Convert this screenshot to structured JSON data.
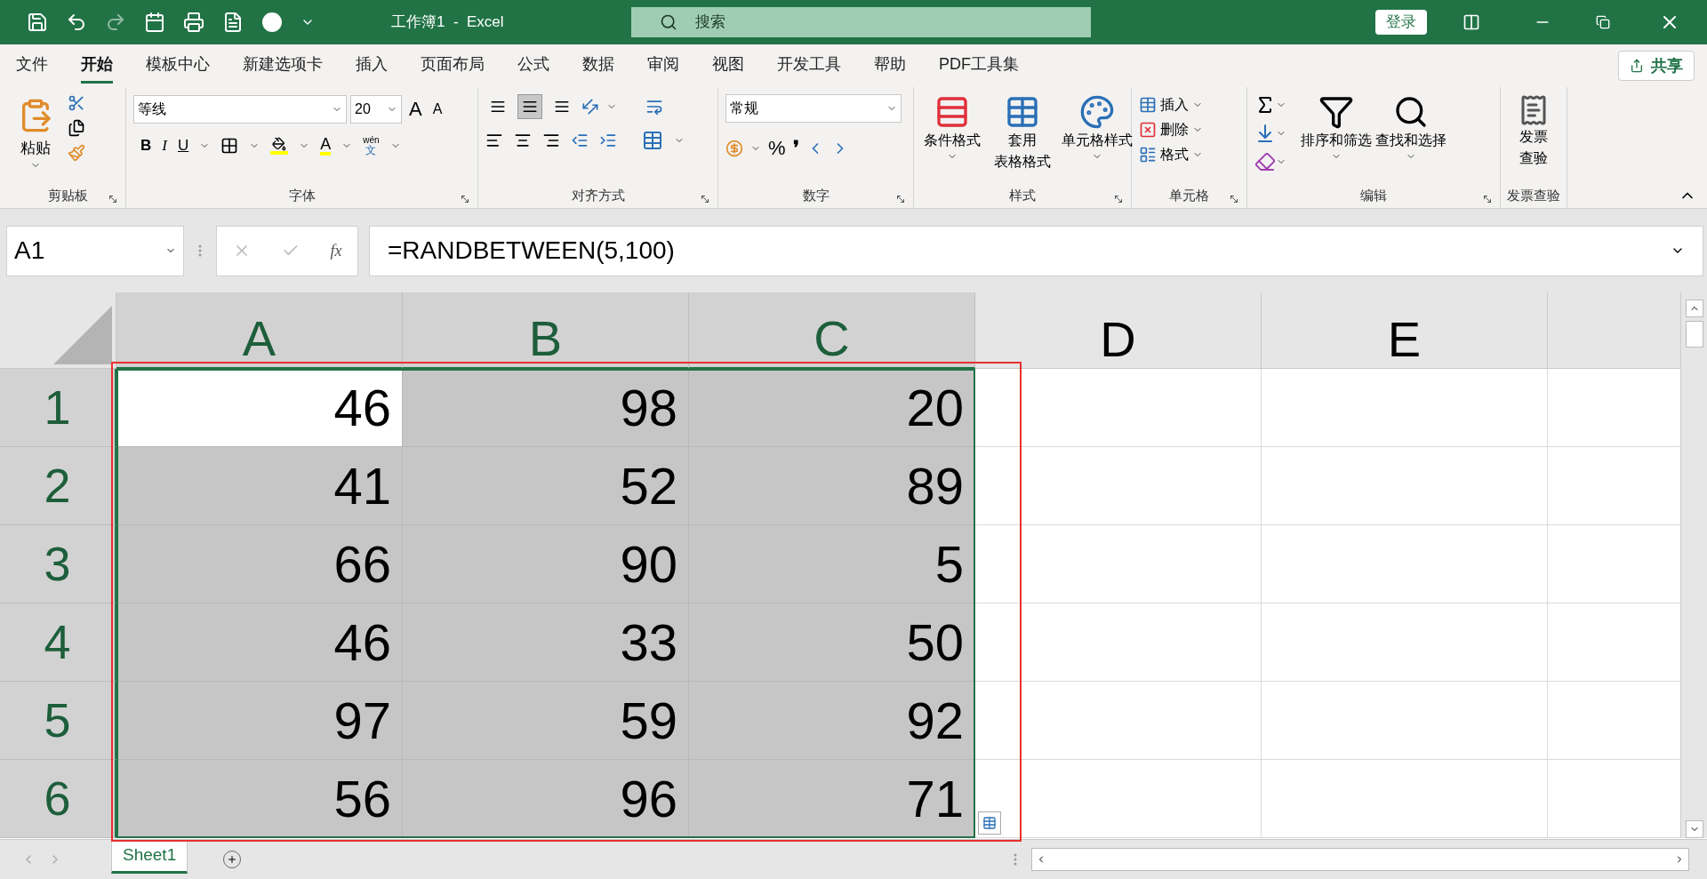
{
  "title_bar": {
    "title": "工作簿1  -  Excel",
    "search_placeholder": "搜索",
    "login": "登录"
  },
  "menu_tabs": [
    {
      "label": "文件",
      "selected": false
    },
    {
      "label": "开始",
      "selected": true
    },
    {
      "label": "模板中心",
      "selected": false
    },
    {
      "label": "新建选项卡",
      "selected": false
    },
    {
      "label": "插入",
      "selected": false
    },
    {
      "label": "页面布局",
      "selected": false
    },
    {
      "label": "公式",
      "selected": false
    },
    {
      "label": "数据",
      "selected": false
    },
    {
      "label": "审阅",
      "selected": false
    },
    {
      "label": "视图",
      "selected": false
    },
    {
      "label": "开发工具",
      "selected": false
    },
    {
      "label": "帮助",
      "selected": false
    },
    {
      "label": "PDF工具集",
      "selected": false
    }
  ],
  "share": "共享",
  "ribbon": {
    "clipboard": {
      "paste": "粘贴",
      "label": "剪贴板"
    },
    "font": {
      "name": "等线",
      "size": "20",
      "bold": "B",
      "italic": "I",
      "underline": "U",
      "grow": "A",
      "shrink": "A",
      "color_letter": "A",
      "phonetic_top": "wén",
      "phonetic_bottom": "文",
      "label": "字体"
    },
    "alignment": {
      "vertical": [
        {
          "selected": false
        },
        {
          "selected": true
        },
        {
          "selected": false
        }
      ],
      "label": "对齐方式"
    },
    "number": {
      "format": "常规",
      "percent": "%",
      "comma": "❜",
      "label": "数字"
    },
    "styles": {
      "conditional": "条件格式",
      "table_top": "套用",
      "table_bottom": "表格格式",
      "cell_styles": "单元格样式",
      "label": "样式"
    },
    "cells": {
      "insert": "插入",
      "delete": "删除",
      "format": "格式",
      "label": "单元格"
    },
    "editing": {
      "sort": "排序和筛选",
      "find": "查找和选择",
      "label": "编辑"
    },
    "invoice": {
      "top": "发票",
      "bottom": "查验",
      "label": "发票查验"
    }
  },
  "formula_bar": {
    "name_box": "A1",
    "fx": "fx",
    "formula": "=RANDBETWEEN(5,100)"
  },
  "columns": [
    {
      "label": "A",
      "selected": true
    },
    {
      "label": "B",
      "selected": true
    },
    {
      "label": "C",
      "selected": true
    },
    {
      "label": "D",
      "selected": false
    },
    {
      "label": "E",
      "selected": false
    }
  ],
  "rows": [
    {
      "label": "1",
      "selected": true,
      "cells": [
        {
          "value": "46",
          "selected": true,
          "active": true
        },
        {
          "value": "98",
          "selected": true,
          "active": false
        },
        {
          "value": "20",
          "selected": true,
          "active": false
        }
      ]
    },
    {
      "label": "2",
      "selected": true,
      "cells": [
        {
          "value": "41",
          "selected": true,
          "active": false
        },
        {
          "value": "52",
          "selected": true,
          "active": false
        },
        {
          "value": "89",
          "selected": true,
          "active": false
        }
      ]
    },
    {
      "label": "3",
      "selected": true,
      "cells": [
        {
          "value": "66",
          "selected": true,
          "active": false
        },
        {
          "value": "90",
          "selected": true,
          "active": false
        },
        {
          "value": "5",
          "selected": true,
          "active": false
        }
      ]
    },
    {
      "label": "4",
      "selected": true,
      "cells": [
        {
          "value": "46",
          "selected": true,
          "active": false
        },
        {
          "value": "33",
          "selected": true,
          "active": false
        },
        {
          "value": "50",
          "selected": true,
          "active": false
        }
      ]
    },
    {
      "label": "5",
      "selected": true,
      "cells": [
        {
          "value": "97",
          "selected": true,
          "active": false
        },
        {
          "value": "59",
          "selected": true,
          "active": false
        },
        {
          "value": "92",
          "selected": true,
          "active": false
        }
      ]
    },
    {
      "label": "6",
      "selected": true,
      "cells": [
        {
          "value": "56",
          "selected": true,
          "active": false
        },
        {
          "value": "96",
          "selected": true,
          "active": false
        },
        {
          "value": "71",
          "selected": true,
          "active": false
        }
      ]
    }
  ],
  "sheet_tabs": [
    {
      "label": "Sheet1",
      "selected": true
    }
  ]
}
